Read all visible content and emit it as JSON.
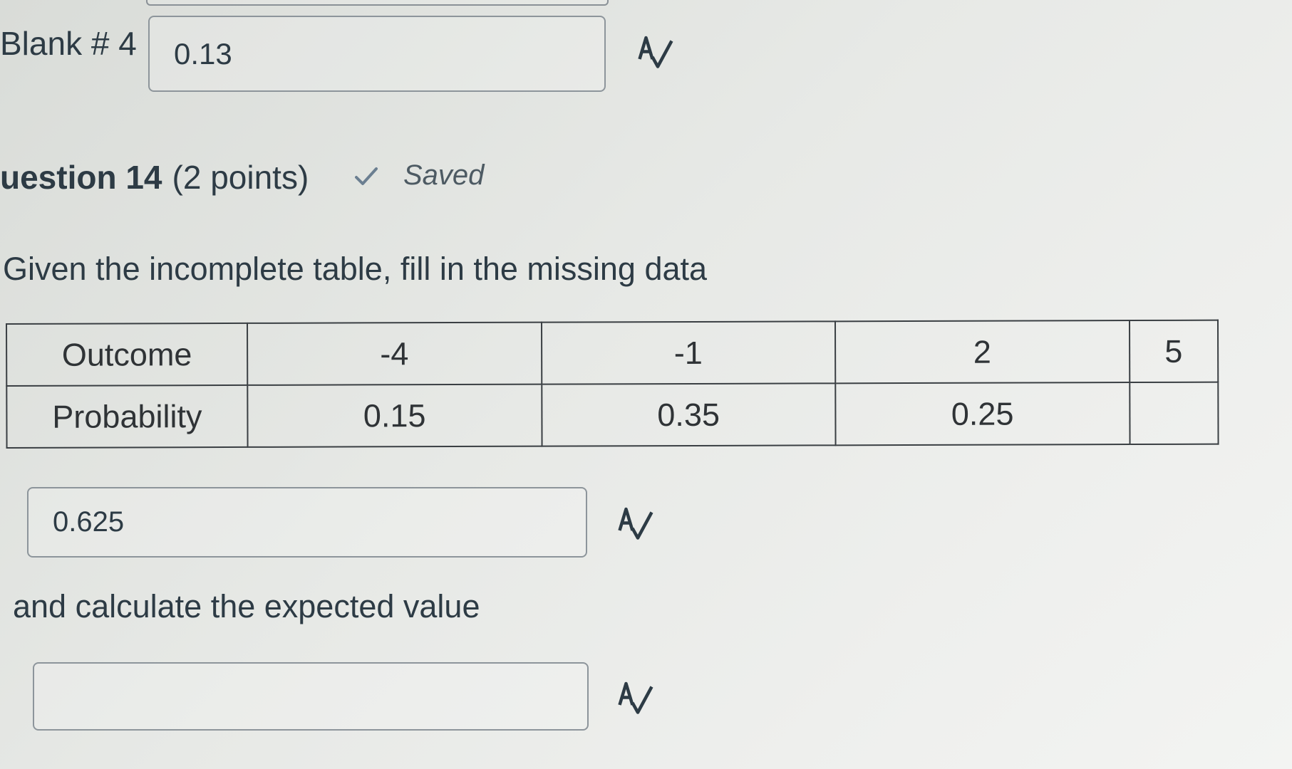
{
  "blank4": {
    "label": "Blank # 4",
    "value": "0.13"
  },
  "question": {
    "number_text": "uestion 14",
    "points_text": "(2 points)",
    "status": "Saved"
  },
  "prompt": "Given the incomplete table, fill in the missing data",
  "table": {
    "row1": [
      "Outcome",
      "-4",
      "-1",
      "2",
      "5"
    ],
    "row2": [
      "Probability",
      "0.15",
      "0.35",
      "0.25",
      ""
    ]
  },
  "probability_answer": {
    "value": "0.625"
  },
  "followup": "and calculate the expected value",
  "expected_value_answer": {
    "value": ""
  },
  "icons": {
    "spellcheck": "spellcheck-icon",
    "saved": "checkmark-icon"
  }
}
